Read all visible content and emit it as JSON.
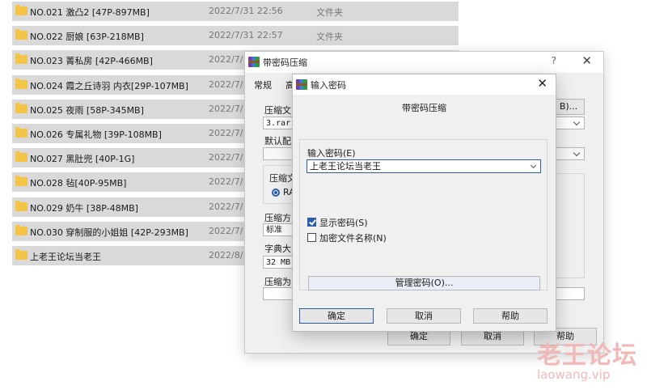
{
  "file_list": [
    {
      "name": "NO.021 激凸2 [47P-897MB]",
      "date": "2022/7/31 22:56",
      "type": "文件夹"
    },
    {
      "name": "NO.022 厨娘 [63P-218MB]",
      "date": "2022/7/31 22:57",
      "type": "文件夹"
    },
    {
      "name": "NO.023 菁私房 [42P-466MB]",
      "date": "2022/7/",
      "type": ""
    },
    {
      "name": "NO.024 霞之丘诗羽 内衣[29P-107MB]",
      "date": "2022/7/",
      "type": ""
    },
    {
      "name": "NO.025 夜雨 [58P-345MB]",
      "date": "2022/7/",
      "type": ""
    },
    {
      "name": "NO.026 专属礼物 [39P-108MB]",
      "date": "2022/7/",
      "type": ""
    },
    {
      "name": "NO.027 黑肚兜 [40P-1G]",
      "date": "2022/7/",
      "type": ""
    },
    {
      "name": "NO.028 毡[40P-95MB]",
      "date": "2022/7/",
      "type": ""
    },
    {
      "name": "NO.029 奶牛 [38P-48MB]",
      "date": "2022/7/",
      "type": ""
    },
    {
      "name": "NO.030 穿制服的小姐姐 [42P-293MB]",
      "date": "2022/7/",
      "type": ""
    },
    {
      "name": "上老王论坛当老王",
      "date": "2022/8/",
      "type": ""
    }
  ],
  "archive_dialog": {
    "title": "带密码压缩",
    "help": "?",
    "close": "✕",
    "tabs": [
      "常规",
      "高"
    ],
    "archive_name_label": "压缩文",
    "archive_name_value": "3.rar",
    "browse_label": "B)...",
    "default_profile_label": "默认配",
    "format_group_label": "压缩文",
    "format_rar": "RA",
    "method_label": "压缩方",
    "method_value": "标准",
    "dict_label": "字典大",
    "dict_value": "32 MB",
    "split_label": "压缩为",
    "ok": "确定",
    "cancel": "取消",
    "help_button": "帮助"
  },
  "password_dialog": {
    "title": "输入密码",
    "close": "✕",
    "heading": "带密码压缩",
    "password_label": "输入密码(E)",
    "password_value": "上老王论坛当老王",
    "show_password": "显示密码(S)",
    "show_password_checked": true,
    "encrypt_names": "加密文件名称(N)",
    "encrypt_names_checked": false,
    "manage_button": "管理密码(O)...",
    "ok": "确定",
    "cancel": "取消",
    "help_button": "帮助"
  },
  "watermark": {
    "title": "老王论坛",
    "url": "laowang.vip"
  }
}
